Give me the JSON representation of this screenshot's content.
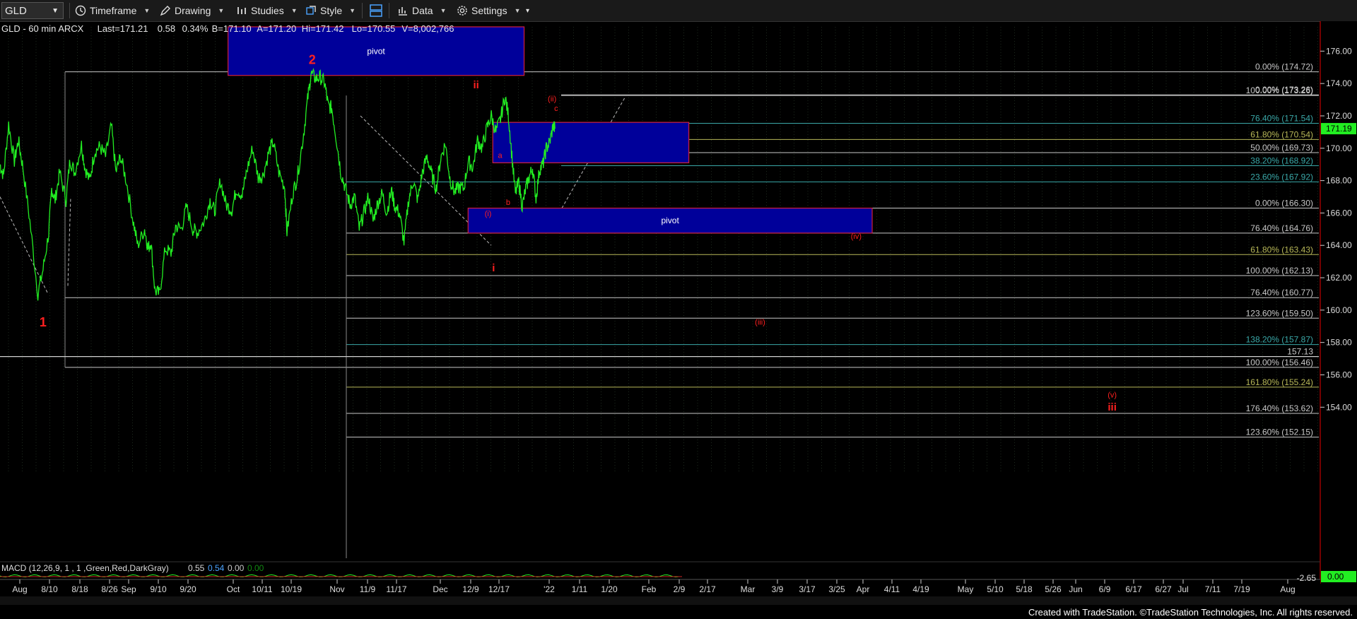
{
  "toolbar": {
    "symbol": "GLD",
    "timeframe": "Timeframe",
    "drawing": "Drawing",
    "studies": "Studies",
    "style": "Style",
    "data": "Data",
    "settings": "Settings"
  },
  "footer": "Created with TradeStation. ©TradeStation Technologies, Inc. All rights reserved.",
  "chart_data": {
    "type": "line",
    "header": {
      "symbol_line": "GLD - 60 min  ARCX",
      "last": "Last=171.21",
      "change": "0.58",
      "pct": "0.34%",
      "bid": "B=171.10",
      "ask": "A=171.20",
      "hi": "Hi=171.42",
      "lo": "Lo=170.55",
      "vol": "V=8,002,766"
    },
    "colors": {
      "price": "#22ee22",
      "wave_label": "#ff2020",
      "pivot_fill": "#00009a",
      "pivot_border": "#d02040",
      "fib_white": "#c8c8c8",
      "fib_olive": "#b8b858",
      "fib_teal": "#3aa8a8"
    },
    "y_range": [
      151,
      177.5
    ],
    "y_ticks": [
      176,
      174,
      172,
      170,
      168,
      166,
      164,
      162,
      160,
      158,
      156,
      154
    ],
    "x_ticks": [
      "Aug",
      "8/10",
      "8/18",
      "8/26",
      "Sep",
      "9/10",
      "9/20",
      "Oct",
      "10/11",
      "10/19",
      "Nov",
      "11/9",
      "11/17",
      "Dec",
      "12/9",
      "12/17",
      "'22",
      "1/11",
      "1/20",
      "Feb",
      "2/9",
      "2/17",
      "Mar",
      "3/9",
      "3/17",
      "3/25",
      "Apr",
      "4/11",
      "4/19",
      "May",
      "5/10",
      "5/18",
      "5/26",
      "Jun",
      "6/9",
      "6/17",
      "6/27",
      "Jul",
      "7/11",
      "7/19",
      "Aug"
    ],
    "last_price_tag": "171.19",
    "price_series": [
      {
        "t": 0,
        "v": 169
      },
      {
        "t": 0.6,
        "v": 168.3
      },
      {
        "t": 1.5,
        "v": 171.5
      },
      {
        "t": 2.5,
        "v": 169.2
      },
      {
        "t": 3.2,
        "v": 170.5
      },
      {
        "t": 4.0,
        "v": 168.8
      },
      {
        "t": 5.2,
        "v": 165.5
      },
      {
        "t": 6.6,
        "v": 161.0
      },
      {
        "t": 7.5,
        "v": 162.5
      },
      {
        "t": 8.5,
        "v": 164.8
      },
      {
        "t": 9.0,
        "v": 167.5
      },
      {
        "t": 9.6,
        "v": 166.8
      },
      {
        "t": 10.4,
        "v": 168.5
      },
      {
        "t": 11.5,
        "v": 166.8
      },
      {
        "t": 12.2,
        "v": 169.3
      },
      {
        "t": 13.0,
        "v": 168.5
      },
      {
        "t": 14.2,
        "v": 170.2
      },
      {
        "t": 14.8,
        "v": 168.8
      },
      {
        "t": 15.6,
        "v": 168.0
      },
      {
        "t": 16.5,
        "v": 169.8
      },
      {
        "t": 17.4,
        "v": 170.1
      },
      {
        "t": 18.4,
        "v": 169.5
      },
      {
        "t": 19.4,
        "v": 171.4
      },
      {
        "t": 20.2,
        "v": 168.5
      },
      {
        "t": 21.0,
        "v": 169.5
      },
      {
        "t": 22.0,
        "v": 168.0
      },
      {
        "t": 23.2,
        "v": 165.5
      },
      {
        "t": 24.0,
        "v": 164.0
      },
      {
        "t": 25.2,
        "v": 165.0
      },
      {
        "t": 25.8,
        "v": 163.8
      },
      {
        "t": 26.3,
        "v": 164.2
      },
      {
        "t": 27.0,
        "v": 161.2
      },
      {
        "t": 27.8,
        "v": 161.0
      },
      {
        "t": 28.8,
        "v": 163.8
      },
      {
        "t": 29.8,
        "v": 163.5
      },
      {
        "t": 30.6,
        "v": 165.2
      },
      {
        "t": 31.6,
        "v": 165.0
      },
      {
        "t": 32.5,
        "v": 166.4
      },
      {
        "t": 33.6,
        "v": 165.0
      },
      {
        "t": 34.4,
        "v": 164.8
      },
      {
        "t": 35.6,
        "v": 165.5
      },
      {
        "t": 36.6,
        "v": 166.8
      },
      {
        "t": 37.4,
        "v": 166.1
      },
      {
        "t": 38.4,
        "v": 168.0
      },
      {
        "t": 39.4,
        "v": 166.5
      },
      {
        "t": 40.4,
        "v": 166.2
      },
      {
        "t": 41.2,
        "v": 167.5
      },
      {
        "t": 42.2,
        "v": 167.1
      },
      {
        "t": 43.0,
        "v": 168.6
      },
      {
        "t": 44.0,
        "v": 170.0
      },
      {
        "t": 45.0,
        "v": 168.2
      },
      {
        "t": 45.8,
        "v": 168.3
      },
      {
        "t": 46.8,
        "v": 169.7
      },
      {
        "t": 47.6,
        "v": 170.4
      },
      {
        "t": 48.6,
        "v": 168.5
      },
      {
        "t": 49.6,
        "v": 167.6
      },
      {
        "t": 50.0,
        "v": 164.8
      },
      {
        "t": 51.0,
        "v": 167.2
      },
      {
        "t": 51.8,
        "v": 168.2
      },
      {
        "t": 52.8,
        "v": 170.6
      },
      {
        "t": 53.6,
        "v": 173.0
      },
      {
        "t": 54.2,
        "v": 174.6
      },
      {
        "t": 55.0,
        "v": 174.3
      },
      {
        "t": 55.8,
        "v": 174.4
      },
      {
        "t": 56.6,
        "v": 174.0
      },
      {
        "t": 57.2,
        "v": 172.6
      },
      {
        "t": 57.8,
        "v": 172.5
      },
      {
        "t": 58.6,
        "v": 170.6
      },
      {
        "t": 59.4,
        "v": 168.5
      },
      {
        "t": 60.2,
        "v": 167.5
      },
      {
        "t": 61.0,
        "v": 166.5
      },
      {
        "t": 61.8,
        "v": 167.0
      },
      {
        "t": 62.6,
        "v": 165.0
      },
      {
        "t": 63.4,
        "v": 166.0
      },
      {
        "t": 64.2,
        "v": 167.0
      },
      {
        "t": 65.0,
        "v": 165.5
      },
      {
        "t": 65.8,
        "v": 166.6
      },
      {
        "t": 66.6,
        "v": 167.2
      },
      {
        "t": 67.4,
        "v": 166.0
      },
      {
        "t": 68.2,
        "v": 167.4
      },
      {
        "t": 68.8,
        "v": 166.4
      },
      {
        "t": 69.6,
        "v": 166.0
      },
      {
        "t": 70.4,
        "v": 164.2
      },
      {
        "t": 71.2,
        "v": 166.8
      },
      {
        "t": 72.0,
        "v": 168.0
      },
      {
        "t": 72.8,
        "v": 166.8
      },
      {
        "t": 73.6,
        "v": 168.5
      },
      {
        "t": 74.4,
        "v": 169.5
      },
      {
        "t": 75.2,
        "v": 168.4
      },
      {
        "t": 76.0,
        "v": 167.5
      },
      {
        "t": 76.8,
        "v": 169.4
      },
      {
        "t": 77.6,
        "v": 170.3
      },
      {
        "t": 78.4,
        "v": 168.1
      },
      {
        "t": 79.2,
        "v": 167.3
      },
      {
        "t": 80.0,
        "v": 167.6
      },
      {
        "t": 80.8,
        "v": 167.5
      },
      {
        "t": 81.6,
        "v": 169.2
      },
      {
        "t": 82.4,
        "v": 168.8
      },
      {
        "t": 83.2,
        "v": 170.5
      },
      {
        "t": 84.0,
        "v": 170.0
      },
      {
        "t": 84.8,
        "v": 171.2
      },
      {
        "t": 85.6,
        "v": 172.0
      },
      {
        "t": 86.4,
        "v": 171.0
      },
      {
        "t": 87.2,
        "v": 171.8
      },
      {
        "t": 88.0,
        "v": 173.2
      },
      {
        "t": 88.6,
        "v": 172.0
      },
      {
        "t": 89.2,
        "v": 169.5
      },
      {
        "t": 89.8,
        "v": 167.2
      },
      {
        "t": 90.4,
        "v": 167.9
      },
      {
        "t": 91.0,
        "v": 166.4
      },
      {
        "t": 91.6,
        "v": 167.5
      },
      {
        "t": 92.2,
        "v": 168.2
      },
      {
        "t": 92.8,
        "v": 168.8
      },
      {
        "t": 93.4,
        "v": 166.9
      },
      {
        "t": 94.0,
        "v": 168.7
      },
      {
        "t": 94.6,
        "v": 169.0
      },
      {
        "t": 95.2,
        "v": 170.0
      },
      {
        "t": 95.8,
        "v": 170.4
      },
      {
        "t": 96.4,
        "v": 171.4
      },
      {
        "t": 96.7,
        "v": 171.2
      }
    ],
    "fib_labels": [
      {
        "text": "0.00% (174.72)",
        "price": 174.72,
        "color": "fib_white"
      },
      {
        "text": "100.00% (173.26)",
        "price": 173.26,
        "color": "fib_white"
      },
      {
        "text": "0.00% (173.26)",
        "price": 173.3,
        "color": "fib_white"
      },
      {
        "text": "76.40% (171.54)",
        "price": 171.54,
        "color": "fib_teal"
      },
      {
        "text": "61.80% (170.54)",
        "price": 170.54,
        "color": "fib_olive"
      },
      {
        "text": "50.00% (169.73)",
        "price": 169.73,
        "color": "fib_white"
      },
      {
        "text": "38.20% (168.92)",
        "price": 168.92,
        "color": "fib_teal"
      },
      {
        "text": "23.60% (167.92)",
        "price": 167.92,
        "color": "fib_teal"
      },
      {
        "text": "0.00% (166.30)",
        "price": 166.3,
        "color": "fib_white"
      },
      {
        "text": "76.40% (164.76)",
        "price": 164.76,
        "color": "fib_white"
      },
      {
        "text": "61.80% (163.43)",
        "price": 163.43,
        "color": "fib_olive"
      },
      {
        "text": "100.00% (162.13)",
        "price": 162.13,
        "color": "fib_white"
      },
      {
        "text": "76.40% (160.77)",
        "price": 160.77,
        "color": "fib_white"
      },
      {
        "text": "123.60% (159.50)",
        "price": 159.5,
        "color": "fib_white"
      },
      {
        "text": "138.20% (157.87)",
        "price": 157.87,
        "color": "fib_teal"
      },
      {
        "text": "157.13",
        "price": 157.13,
        "color": "fib_white"
      },
      {
        "text": "100.00% (156.46)",
        "price": 156.46,
        "color": "fib_white"
      },
      {
        "text": "161.80% (155.24)",
        "price": 155.24,
        "color": "fib_olive"
      },
      {
        "text": "176.40% (153.62)",
        "price": 153.62,
        "color": "fib_white"
      },
      {
        "text": "123.60% (152.15)",
        "price": 152.15,
        "color": "fib_white"
      }
    ],
    "pivot_zones": [
      {
        "label": "pivot",
        "t0": 57,
        "t1": 131,
        "top": 177.5,
        "bottom": 174.5
      },
      {
        "label": "pivot",
        "t0": 117,
        "t1": 218,
        "top": 166.3,
        "bottom": 164.76
      }
    ],
    "small_box": {
      "t0": 123,
      "t1": 172,
      "top": 171.6,
      "bottom": 169.1
    },
    "wave_labels": [
      {
        "text": "1",
        "t": 7.5,
        "price": 159.0,
        "size": "big"
      },
      {
        "text": "2",
        "t": 54.4,
        "price": 175.2,
        "size": "big"
      },
      {
        "text": "i",
        "t": 86.0,
        "price": 162.4,
        "size": "mid"
      },
      {
        "text": "ii",
        "t": 119,
        "price": 173.7,
        "size": "mid"
      },
      {
        "text": "(ii)",
        "t": 138,
        "price": 172.9,
        "size": "small"
      },
      {
        "text": "c",
        "t": 139,
        "price": 172.3,
        "size": "small"
      },
      {
        "text": "a",
        "t": 125,
        "price": 169.4,
        "size": "small"
      },
      {
        "text": "b",
        "t": 127,
        "price": 166.5,
        "size": "small"
      },
      {
        "text": "(i)",
        "t": 122,
        "price": 165.8,
        "size": "small"
      },
      {
        "text": "(iv)",
        "t": 214,
        "price": 164.4,
        "size": "small"
      },
      {
        "text": "(iii)",
        "t": 190,
        "price": 159.1,
        "size": "small"
      },
      {
        "text": "(v)",
        "t": 278,
        "price": 154.6,
        "size": "small"
      },
      {
        "text": "iii",
        "t": 278,
        "price": 153.8,
        "size": "mid"
      }
    ],
    "macd": {
      "title": "MACD (12,26,9, 1 , 1 ,Green,Red,DarkGray)",
      "values": [
        "0.55",
        "0.54",
        "0.00",
        "0.00"
      ],
      "right_tag": "0.00",
      "low_label": "-2.65"
    }
  }
}
